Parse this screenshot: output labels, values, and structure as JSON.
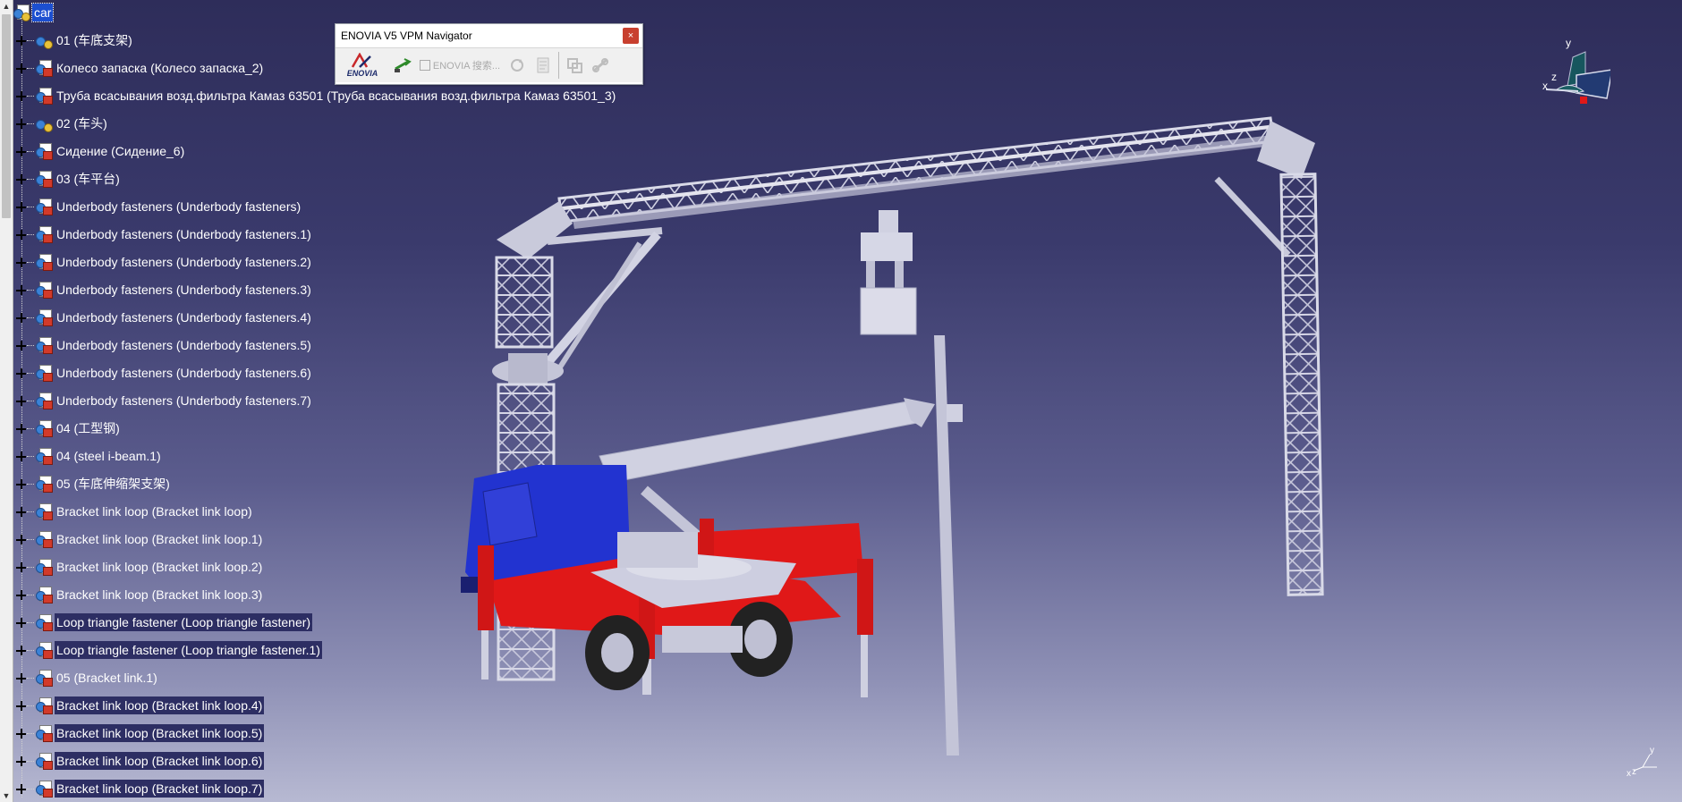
{
  "tree": {
    "root": "car",
    "items": [
      {
        "label": "01 (车底支架)",
        "icon": "gear",
        "style": "plain"
      },
      {
        "label": "Колесо запаска (Колесо запаска_2)",
        "icon": "part",
        "style": "plain"
      },
      {
        "label": "Труба всасывания возд.фильтра Камаз 63501 (Труба всасывания возд.фильтра Камаз 63501_3)",
        "icon": "part",
        "style": "plain"
      },
      {
        "label": "02 (车头)",
        "icon": "gear",
        "style": "plain"
      },
      {
        "label": "Сидение (Сидение_6)",
        "icon": "part",
        "style": "plain"
      },
      {
        "label": "03 (车平台)",
        "icon": "part",
        "style": "plain"
      },
      {
        "label": "Underbody fasteners (Underbody fasteners)",
        "icon": "part",
        "style": "plain"
      },
      {
        "label": "Underbody fasteners (Underbody fasteners.1)",
        "icon": "part",
        "style": "plain"
      },
      {
        "label": "Underbody fasteners (Underbody fasteners.2)",
        "icon": "part",
        "style": "plain"
      },
      {
        "label": "Underbody fasteners (Underbody fasteners.3)",
        "icon": "part",
        "style": "plain"
      },
      {
        "label": "Underbody fasteners (Underbody fasteners.4)",
        "icon": "part",
        "style": "plain"
      },
      {
        "label": "Underbody fasteners (Underbody fasteners.5)",
        "icon": "part",
        "style": "plain"
      },
      {
        "label": "Underbody fasteners (Underbody fasteners.6)",
        "icon": "part",
        "style": "plain"
      },
      {
        "label": "Underbody fasteners (Underbody fasteners.7)",
        "icon": "part",
        "style": "plain"
      },
      {
        "label": "04 (工型钢)",
        "icon": "part",
        "style": "plain"
      },
      {
        "label": "04 (steel i-beam.1)",
        "icon": "part",
        "style": "plain"
      },
      {
        "label": "05 (车底伸缩架支架)",
        "icon": "part",
        "style": "plain"
      },
      {
        "label": "Bracket link loop (Bracket link loop)",
        "icon": "part",
        "style": "plain"
      },
      {
        "label": "Bracket link loop (Bracket link loop.1)",
        "icon": "part",
        "style": "plain"
      },
      {
        "label": "Bracket link loop (Bracket link loop.2)",
        "icon": "part",
        "style": "plain"
      },
      {
        "label": "Bracket link loop (Bracket link loop.3)",
        "icon": "part",
        "style": "plain"
      },
      {
        "label": "Loop triangle fastener (Loop triangle fastener)",
        "icon": "part",
        "style": "hl"
      },
      {
        "label": "Loop triangle fastener (Loop triangle fastener.1)",
        "icon": "part",
        "style": "hl"
      },
      {
        "label": "05 (Bracket link.1)",
        "icon": "part",
        "style": "plain"
      },
      {
        "label": "Bracket link loop (Bracket link loop.4)",
        "icon": "part",
        "style": "hl"
      },
      {
        "label": "Bracket link loop (Bracket link loop.5)",
        "icon": "part",
        "style": "hl"
      },
      {
        "label": "Bracket link loop (Bracket link loop.6)",
        "icon": "part",
        "style": "hl"
      },
      {
        "label": "Bracket link loop (Bracket link loop.7)",
        "icon": "part",
        "style": "hl"
      }
    ]
  },
  "enovia": {
    "title": "ENOVIA V5 VPM Navigator",
    "close": "×",
    "logo": "ENOVIA",
    "search_label": "ENOVIA 搜索..."
  },
  "compass": {
    "x": "x",
    "y": "y",
    "z": "z"
  },
  "mini_axis": {
    "x": "x",
    "y": "y",
    "z": "z"
  },
  "scrollbar": {
    "up": "▲",
    "down": "▼"
  }
}
